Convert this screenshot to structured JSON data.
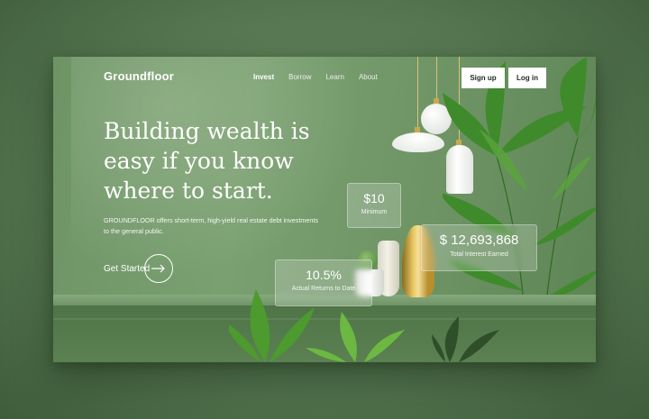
{
  "brand": {
    "name": "Groundfloor"
  },
  "nav": {
    "items": [
      {
        "label": "Invest",
        "active": true
      },
      {
        "label": "Borrow",
        "active": false
      },
      {
        "label": "Learn",
        "active": false
      },
      {
        "label": "About",
        "active": false
      }
    ]
  },
  "auth": {
    "signup_label": "Sign up",
    "login_label": "Log in"
  },
  "hero": {
    "headline": "Building wealth is easy if you know where to start.",
    "subcopy": "GROUNDFLOOR offers short-term, high-yield real estate debt investments to the general public.",
    "cta_label": "Get Started"
  },
  "stats": {
    "minimum": {
      "value": "$10",
      "label": "Minimum"
    },
    "total_interest": {
      "value": "$ 12,693,868",
      "label": "Total Interest Earned"
    },
    "returns": {
      "value": "10.5%",
      "label": "Actual Returns to Date"
    }
  },
  "icons": {
    "cta": "arrow-right-circle-icon"
  },
  "colors": {
    "background": "#5f8058",
    "hero_green": "#7aa071",
    "button_bg": "#ffffff",
    "text": "#ffffff",
    "gold_accent": "#e9c964"
  }
}
